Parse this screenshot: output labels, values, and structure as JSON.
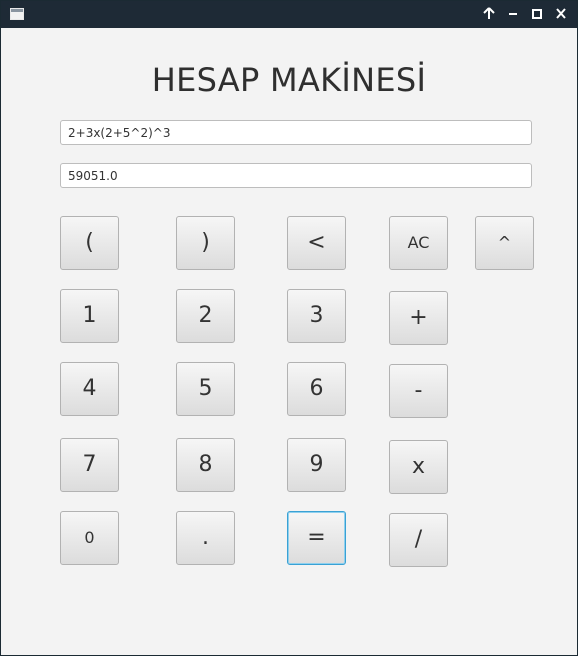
{
  "window": {
    "title_bar": {
      "buttons": [
        {
          "icon": "arrow-up-icon"
        },
        {
          "icon": "minimize-icon"
        },
        {
          "icon": "maximize-icon"
        },
        {
          "icon": "close-icon"
        }
      ]
    }
  },
  "app": {
    "title": "HESAP MAKİNESİ",
    "expression": "2+3x(2+5^2)^3",
    "result": "59051.0"
  },
  "keypad": {
    "open_paren": "(",
    "close_paren": ")",
    "backspace": "<",
    "clear": "AC",
    "power": "^",
    "one": "1",
    "two": "2",
    "three": "3",
    "plus": "+",
    "four": "4",
    "five": "5",
    "six": "6",
    "minus": "-",
    "seven": "7",
    "eight": "8",
    "nine": "9",
    "multiply": "x",
    "zero": "0",
    "dot": ".",
    "equals": "=",
    "divide": "/"
  }
}
